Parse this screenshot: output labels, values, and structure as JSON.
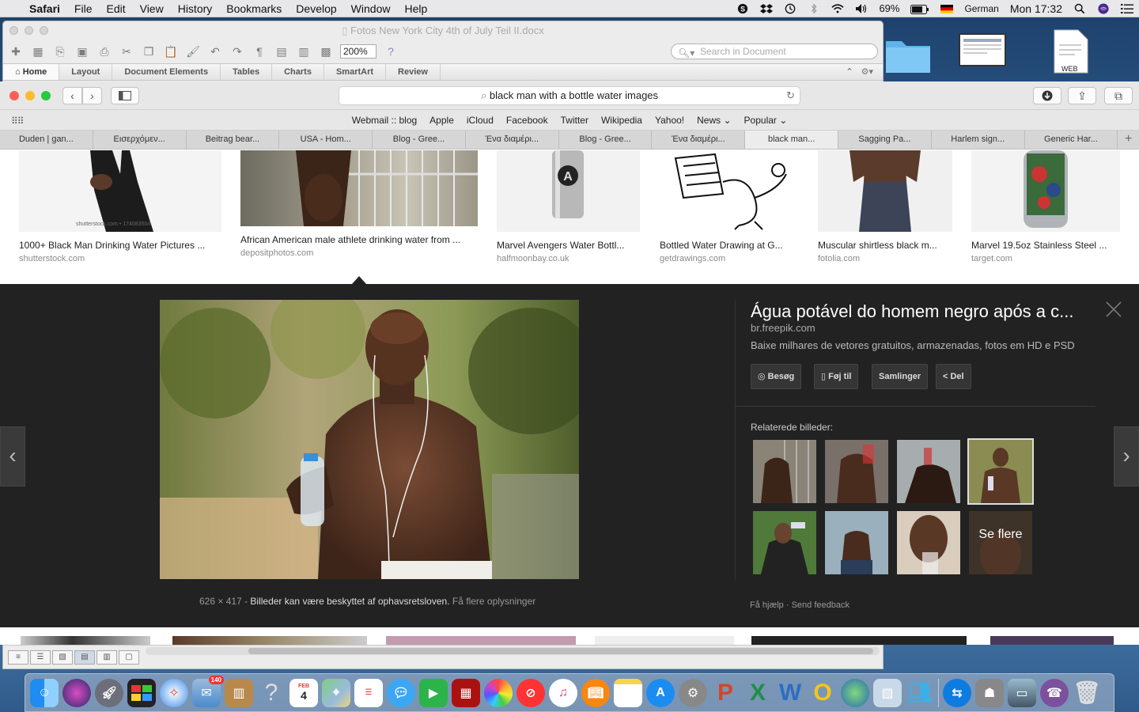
{
  "menubar": {
    "app": "Safari",
    "items": [
      "File",
      "Edit",
      "View",
      "History",
      "Bookmarks",
      "Develop",
      "Window",
      "Help"
    ],
    "battery": "69%",
    "input_source": "German",
    "clock": "Mon 17:32"
  },
  "desktop": {
    "file_label": "WEB"
  },
  "word": {
    "title": "Fotos New York City 4th of July Teil II.docx",
    "zoom": "200%",
    "search_placeholder": "Search in Document",
    "ribbon_tabs": [
      "Home",
      "Layout",
      "Document Elements",
      "Tables",
      "Charts",
      "SmartArt",
      "Review"
    ]
  },
  "safari": {
    "address": "black man with a bottle water images",
    "favorites": [
      "Webmail :: blog",
      "Apple",
      "iCloud",
      "Facebook",
      "Twitter",
      "Wikipedia",
      "Yahoo!",
      "News ⌄",
      "Popular ⌄"
    ],
    "tabs": [
      "Duden | gan...",
      "Εισερχόμεν...",
      "Beitrag bear...",
      "USA - Hom...",
      "Blog - Gree...",
      "Ένα διαμέρι...",
      "Blog - Gree...",
      "Ένα διαμέρι...",
      "black man...",
      "Sagging Pa...",
      "Harlem sign...",
      "Generic Har..."
    ],
    "active_tab_index": 8
  },
  "results": [
    {
      "caption": "1000+ Black Man Drinking Water Pictures ...",
      "source": "shutterstock.com",
      "watermark": "shutterstock.com • 174083504"
    },
    {
      "caption": "African American male athlete drinking water from ...",
      "source": "depositphotos.com"
    },
    {
      "caption": "Marvel Avengers Water Bottl...",
      "source": "halfmoonbay.co.uk"
    },
    {
      "caption": "Bottled Water Drawing at G...",
      "source": "getdrawings.com"
    },
    {
      "caption": "Muscular shirtless black m...",
      "source": "fotolia.com"
    },
    {
      "caption": "Marvel 19.5oz Stainless Steel ...",
      "source": "target.com"
    }
  ],
  "panel": {
    "title": "Água potável do homem negro após a c...",
    "domain": "br.freepik.com",
    "description": "Baixe milhares de vetores gratuitos, armazenadas, fotos em HD e PSD",
    "buttons": {
      "visit": "Besøg",
      "save": "Føj til",
      "collections": "Samlinger",
      "share": "Del"
    },
    "related_label": "Relaterede billeder:",
    "see_more": "Se flere",
    "dimensions": "626 × 417",
    "copyright": "Billeder kan være beskyttet af ophavsretsloven.",
    "more_info": "Få flere oplysninger",
    "help": "Få hjælp",
    "feedback": "Send feedback"
  },
  "dock": {
    "mail_badge": "140",
    "calendar_month": "FEB",
    "calendar_day": "4"
  }
}
